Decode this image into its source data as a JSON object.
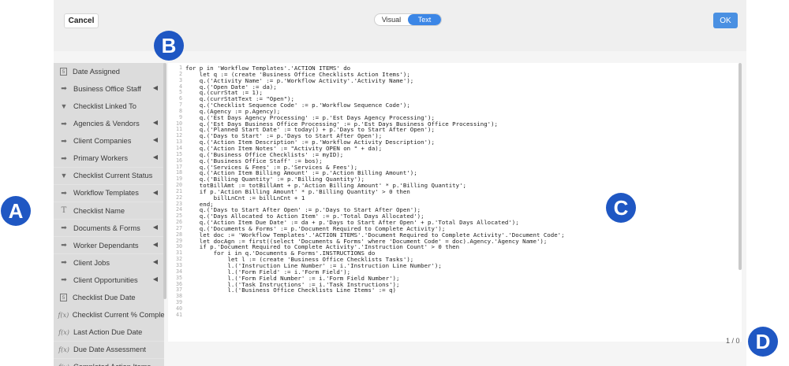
{
  "header": {
    "cancel_label": "Cancel",
    "tabs": [
      {
        "label": "Visual",
        "active": false
      },
      {
        "label": "Text",
        "active": true
      }
    ],
    "ok_label": "OK"
  },
  "fields": [
    {
      "icon": "calendar-icon",
      "label": "Date Assigned",
      "expandable": false
    },
    {
      "icon": "arrow-right-icon",
      "label": "Business Office Staff",
      "expandable": true
    },
    {
      "icon": "triangle-down-icon",
      "label": "Checklist Linked To",
      "expandable": false
    },
    {
      "icon": "arrow-right-icon",
      "label": "Agencies & Vendors",
      "expandable": true
    },
    {
      "icon": "arrow-right-icon",
      "label": "Client Companies",
      "expandable": true
    },
    {
      "icon": "arrow-right-icon",
      "label": "Primary Workers",
      "expandable": true
    },
    {
      "icon": "triangle-down-icon",
      "label": "Checklist Current Status",
      "expandable": false
    },
    {
      "icon": "arrow-right-icon",
      "label": "Workflow Templates",
      "expandable": true
    },
    {
      "icon": "text-icon",
      "label": "Checklist Name",
      "expandable": false
    },
    {
      "icon": "arrow-right-icon",
      "label": "Documents & Forms",
      "expandable": true
    },
    {
      "icon": "arrow-right-icon",
      "label": "Worker Dependants",
      "expandable": true
    },
    {
      "icon": "arrow-right-icon",
      "label": "Client Jobs",
      "expandable": true
    },
    {
      "icon": "arrow-right-icon",
      "label": "Client Opportunities",
      "expandable": true
    },
    {
      "icon": "calendar-icon",
      "label": "Checklist Due Date",
      "expandable": false
    },
    {
      "icon": "function-icon",
      "label": "Checklist Current % Complete",
      "expandable": false
    },
    {
      "icon": "function-icon",
      "label": "Last Action Due Date",
      "expandable": false
    },
    {
      "icon": "function-icon",
      "label": "Due Date Assessment",
      "expandable": false
    },
    {
      "icon": "function-icon",
      "label": "Completed Action Items",
      "expandable": false
    }
  ],
  "glyphs": {
    "calendar-icon": "5",
    "arrow-right-icon": "➡",
    "triangle-down-icon": "▼",
    "text-icon": "T",
    "function-icon": "f(x)",
    "expand": "◀"
  },
  "code_lines": [
    "for p in 'Workflow Templates'.'ACTION ITEMS' do",
    "    let q := (create 'Business Office Checklists Action Items');",
    "    q.('Activity Name' := p.'Workflow Activity'.'Activity Name');",
    "    q.('Open Date' := da);",
    "    q.(currStat := 1);",
    "    q.(currStatText := \"Open\");",
    "    q.('Checklist Sequence Code' := p.'Workflow Sequence Code');",
    "    q.(Agency := p.Agency);",
    "    q.('Est Days Agency Processing' := p.'Est Days Agency Processing');",
    "    q.('Est Days Business Office Processing' := p.'Est Days Business Office Processing');",
    "    q.('Planned Start Date' := today() + p.'Days to Start After Open');",
    "    q.('Days to Start' := p.'Days to Start After Open');",
    "    q.('Action Item Description' := p.'Workflow Activity Description');",
    "    q.('Action Item Notes' := \"Activity OPEN on \" + da);",
    "    q.('Business Office Checklists' := myID);",
    "    q.('Business Office Staff' := bos);",
    "    q.('Services & Fees' := p.'Services & Fees');",
    "    q.('Action Item Billing Amount' := p.'Action Billing Amount');",
    "    q.('Billing Quantity' := p.'Billing Quantity');",
    "    totBillAmt := totBillAmt + p.'Action Billing Amount' * p.'Billing Quantity';",
    "    if p.'Action Billing Amount' * p.'Billing Quantity' > 0 then",
    "        billLnCnt := billLnCnt + 1",
    "    end;",
    "    q.('Days to Start After Open' := p.'Days to Start After Open');",
    "    q.('Days Allocated to Action Item' := p.'Total Days Allocated');",
    "    q.('Action Item Due Date' := da + p.'Days to Start After Open' + p.'Total Days Allocated');",
    "    q.('Documents & Forms' := p.'Document Required to Complete Activity');",
    "    let doc := 'Workflow Templates'.'ACTION ITEMS'.'Document Required to Complete Activity'.'Document Code';",
    "    let docAgn := first((select 'Documents & Forms' where 'Document Code' = doc).Agency.'Agency Name');",
    "    if p.'Document Required to Complete Activity'.'Instruction Count' > 0 then",
    "        for i in q.'Documents & Forms'.INSTRUCTIONS do",
    "            let l := (create 'Business Office Checklists Tasks');",
    "            l.('Instruction Line Number' := i.'Instruction Line Number');",
    "            l.('Form Field' := i.'Form Field');",
    "            l.('Form Field Number' := i.'Form Field Number');",
    "            l.('Task Instructions' := i.'Task Instructions');",
    "            l.('Business Office Checklists Line Items' := q)",
    "",
    "",
    "",
    ""
  ],
  "counter": "1 / 0",
  "callouts": {
    "a": "A",
    "b": "B",
    "c": "C",
    "d": "D"
  }
}
